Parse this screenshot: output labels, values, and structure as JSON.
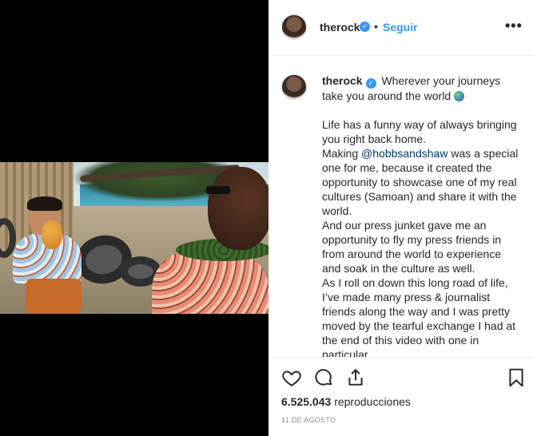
{
  "post": {
    "username": "therock",
    "verified_glyph": "✓",
    "separator": "•",
    "follow_label": "Seguir",
    "more_label": "•••"
  },
  "caption": {
    "username": "therock",
    "intro": "Wherever your journeys take you around the world",
    "p1": "Life has a funny way of always bringing you right back home.",
    "p2_before": "Making ",
    "p2_mention": "@hobbsandshaw",
    "p2_after": " was a special one for me, because it created the opportunity to showcase one of my real cultures (Samoan) and share it with the world.",
    "p3": "And our press junket gave me an opportunity to fly my press friends in from around the world to experience and soak in the culture as well.",
    "p4": "As I roll on down this long road of life, I’ve made many press & journalist friends along the way and I was pretty moved by the tearful exchange I had at the end of this video with one in particular."
  },
  "icons": {
    "like": "heart-icon",
    "comment": "comment-icon",
    "share": "share-icon",
    "save": "bookmark-icon",
    "globe": "globe-emoji-icon"
  },
  "stats": {
    "views_count": "6.525.043",
    "views_label": "reproducciones",
    "date": "11 DE AGOSTO"
  },
  "colors": {
    "link": "#3897f0",
    "mention": "#003569",
    "muted": "#8e8e8e"
  }
}
